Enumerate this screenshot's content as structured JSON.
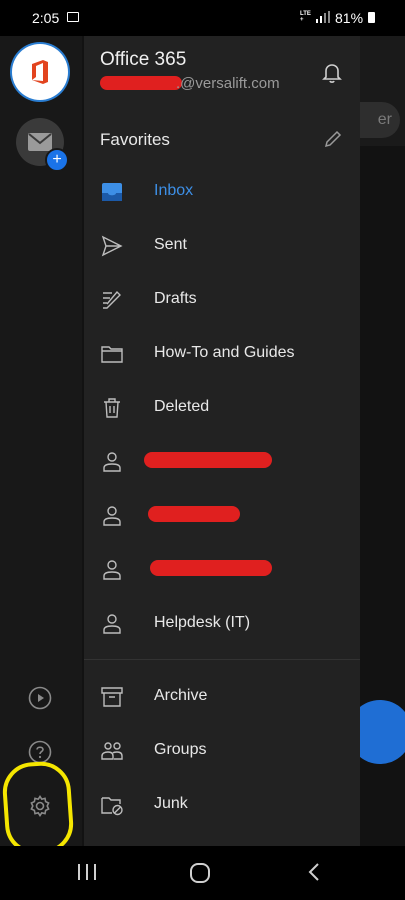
{
  "status_bar": {
    "time": "2:05",
    "network": "LTE+",
    "battery": "81%"
  },
  "background_view": {
    "filter_text": "er"
  },
  "accounts": [
    {
      "name": "office-365-account",
      "icon": "office-logo-icon"
    },
    {
      "name": "mail-account",
      "icon": "mail-icon",
      "badge": "+"
    }
  ],
  "drawer": {
    "account_name": "Office 365",
    "account_email": ".@versalift.com",
    "favorites_label": "Favorites",
    "items": [
      {
        "label": "Inbox",
        "icon": "inbox-icon",
        "active": true
      },
      {
        "label": "Sent",
        "icon": "send-icon"
      },
      {
        "label": "Drafts",
        "icon": "drafts-icon"
      },
      {
        "label": "How-To and Guides",
        "icon": "folder-icon"
      },
      {
        "label": "Deleted",
        "icon": "trash-icon"
      },
      {
        "label": "",
        "icon": "person-icon",
        "redacted": true
      },
      {
        "label": "",
        "icon": "person-icon",
        "redacted": true
      },
      {
        "label": "",
        "icon": "person-icon",
        "redacted": true
      },
      {
        "label": "Helpdesk (IT)",
        "icon": "person-icon"
      },
      {
        "label": "Archive",
        "icon": "archive-icon"
      },
      {
        "label": "Groups",
        "icon": "groups-icon"
      },
      {
        "label": "Junk",
        "icon": "junk-icon"
      }
    ]
  },
  "rail_buttons": [
    "play-icon",
    "help-icon",
    "settings-icon"
  ],
  "colors": {
    "accent": "#3d8fe6",
    "highlight": "#f5e600",
    "redaction": "#e0201f"
  }
}
